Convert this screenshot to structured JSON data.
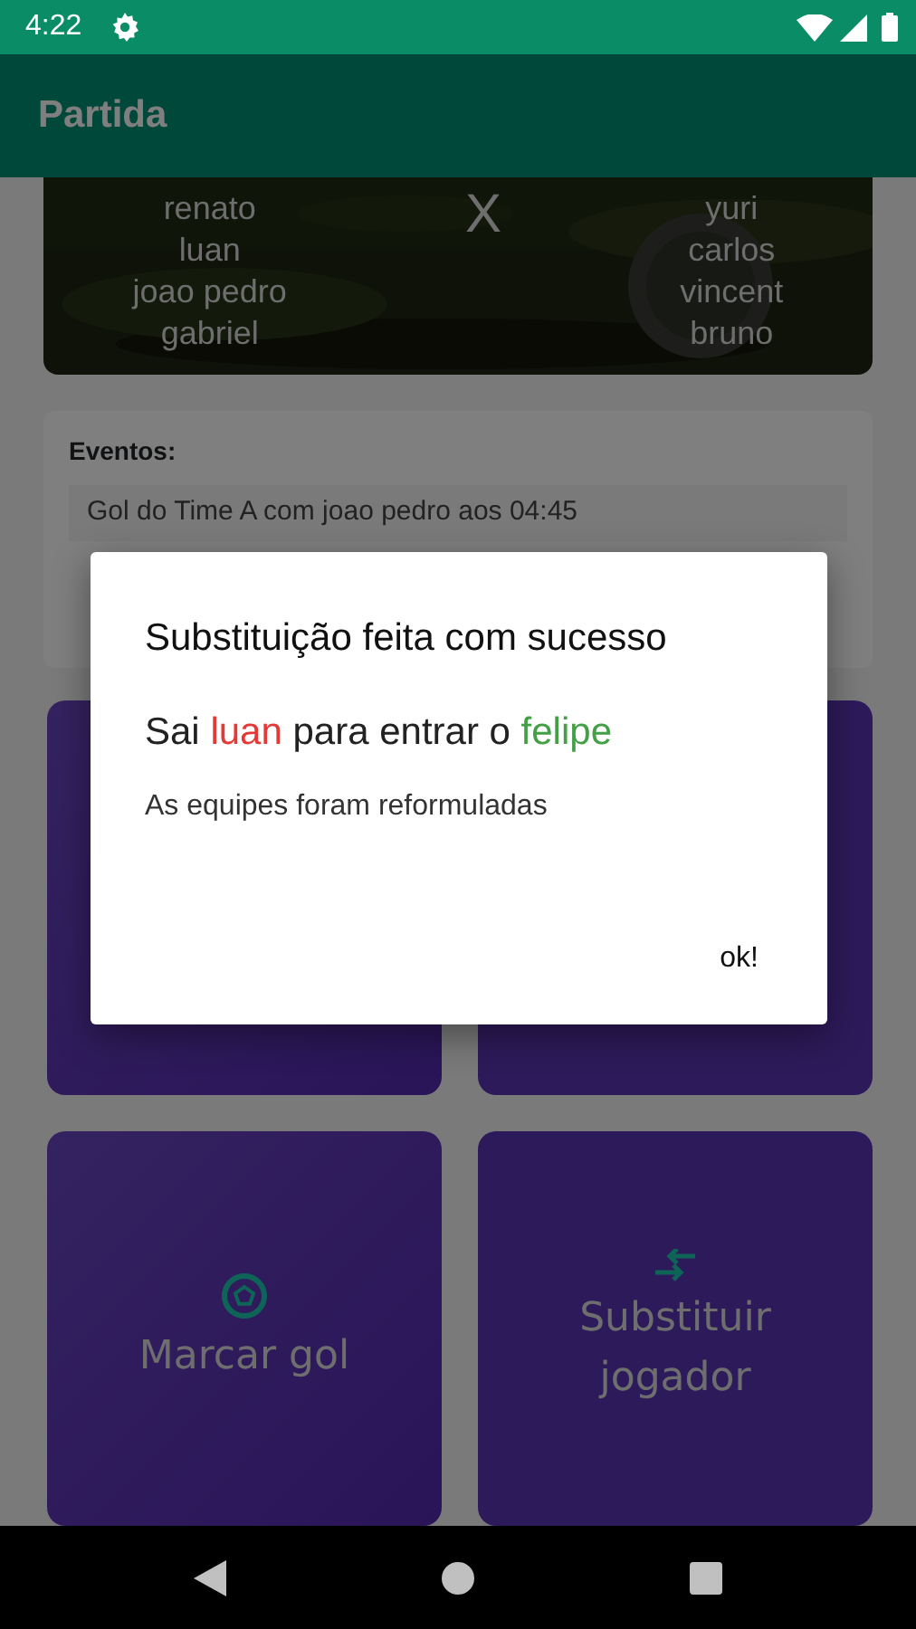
{
  "status_bar": {
    "time": "4:22"
  },
  "app_bar": {
    "title": "Partida"
  },
  "match": {
    "team_a": [
      "renato",
      "luan",
      "joao pedro",
      "gabriel"
    ],
    "separator": "X",
    "team_b": [
      "yuri",
      "carlos",
      "vincent",
      "bruno"
    ]
  },
  "events": {
    "label": "Eventos:",
    "items": [
      "Gol do Time A com joao pedro aos 04:45"
    ]
  },
  "actions": [
    {
      "kind": "blank"
    },
    {
      "kind": "blank"
    },
    {
      "kind": "goal",
      "label": "Marcar gol"
    },
    {
      "kind": "substitute",
      "label": "Substituir jogador"
    }
  ],
  "dialog": {
    "title": "Substituição feita com sucesso",
    "message": [
      {
        "text": "Sai "
      },
      {
        "text": "luan",
        "color": "#e53935"
      },
      {
        "text": " para entrar o "
      },
      {
        "text": "felipe",
        "color": "#43a047"
      }
    ],
    "note": "As equipes foram reformuladas",
    "button": "ok!"
  }
}
